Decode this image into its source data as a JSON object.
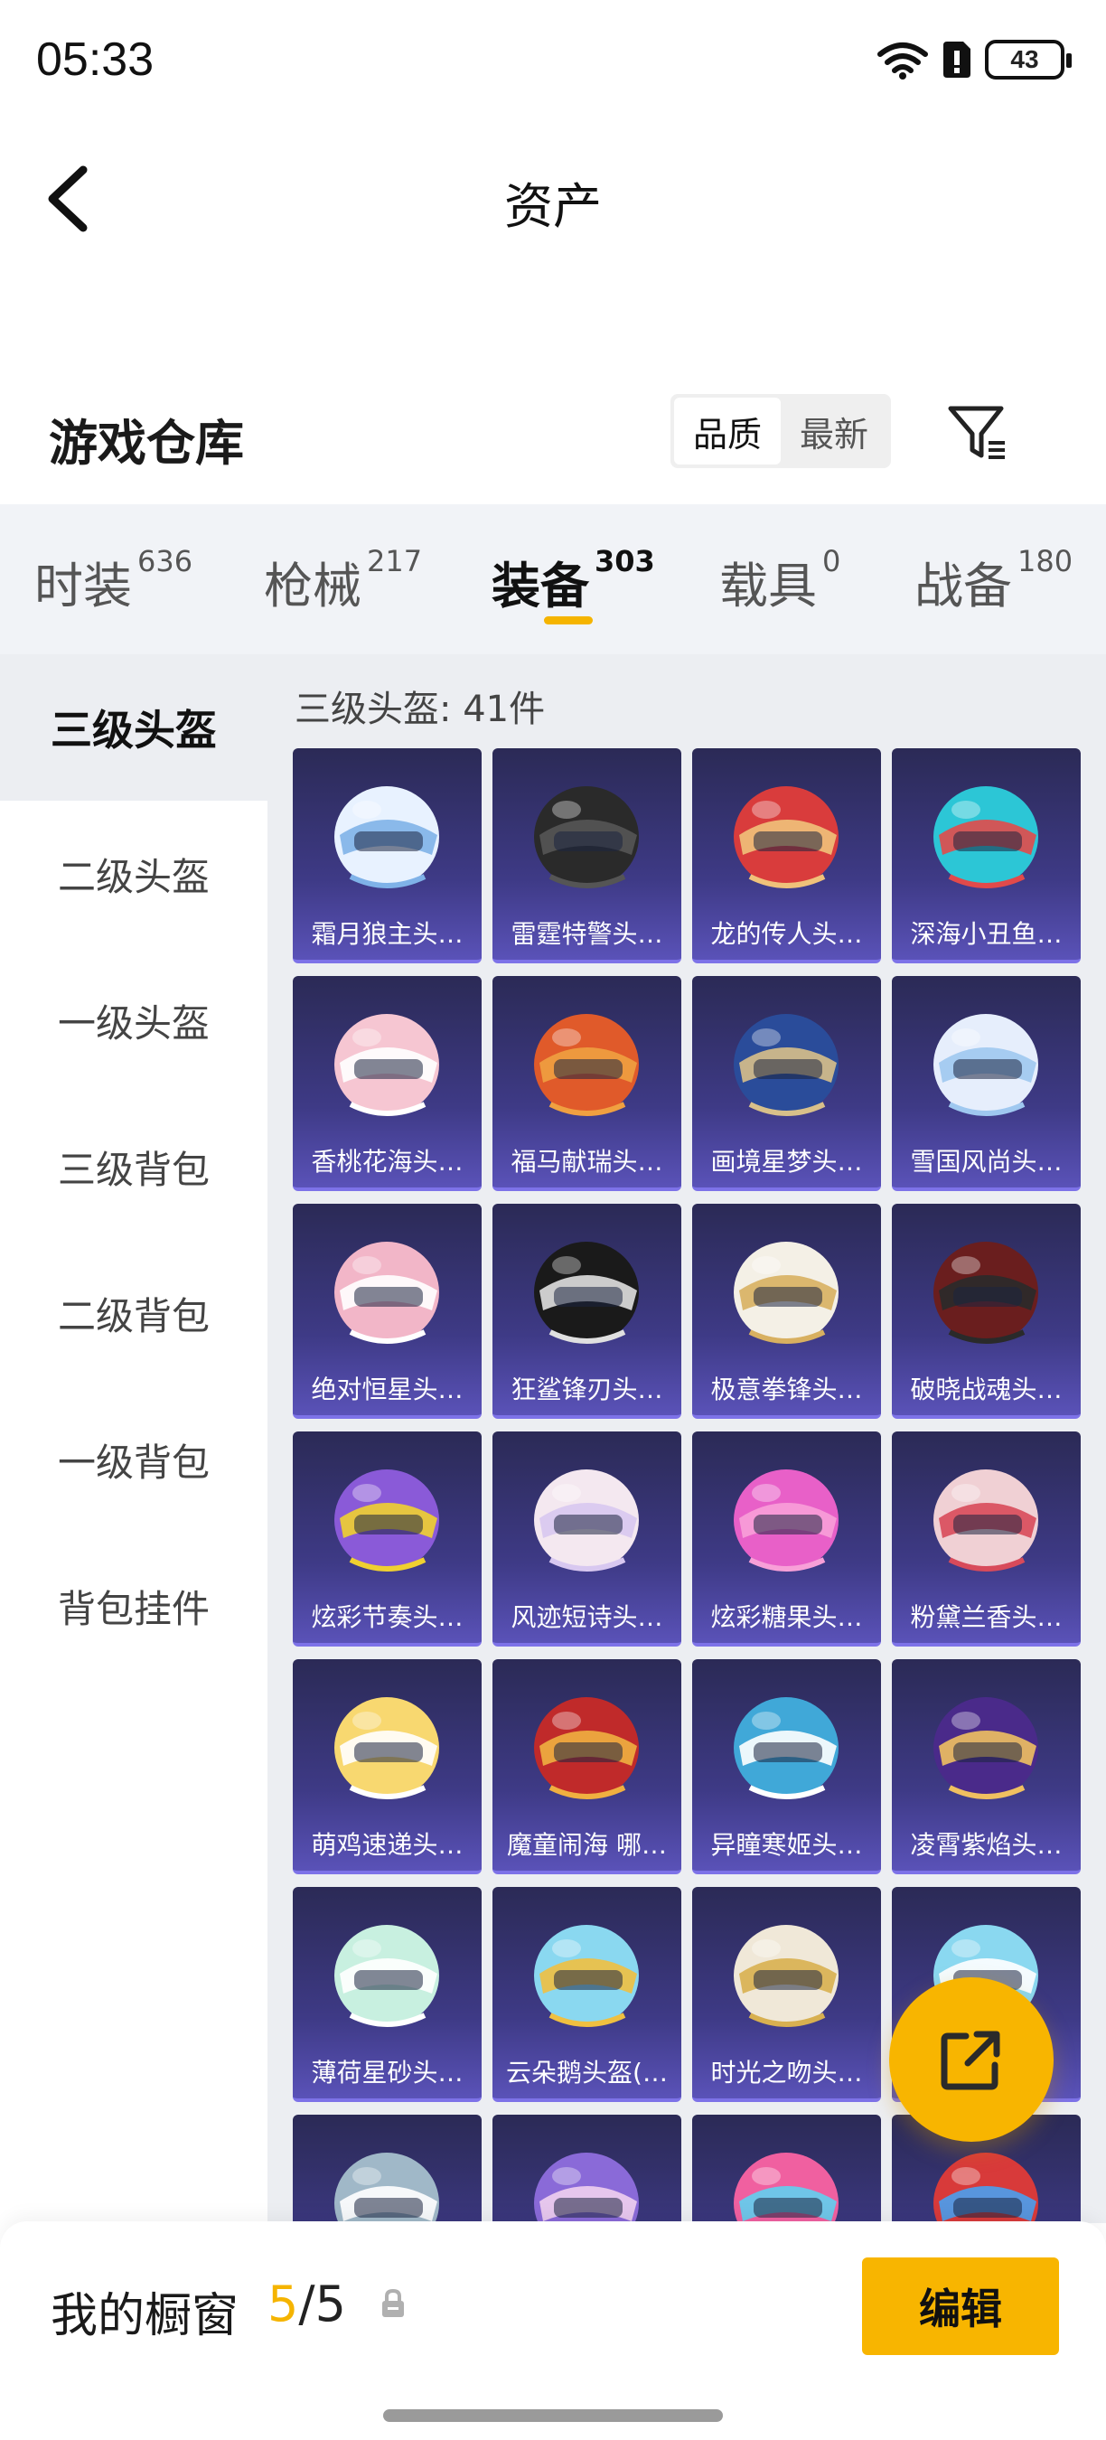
{
  "status_bar": {
    "time": "05:33",
    "battery": "43"
  },
  "header": {
    "title": "资产"
  },
  "warehouse": {
    "title": "游戏仓库",
    "sort_options": [
      "品质",
      "最新"
    ],
    "sort_selected": "品质"
  },
  "tabs": [
    {
      "label": "时装",
      "count": "636"
    },
    {
      "label": "枪械",
      "count": "217"
    },
    {
      "label": "装备",
      "count": "303"
    },
    {
      "label": "载具",
      "count": "0"
    },
    {
      "label": "战备",
      "count": "180"
    }
  ],
  "active_tab": "装备",
  "sidebar": {
    "items": [
      "三级头盔",
      "二级头盔",
      "一级头盔",
      "三级背包",
      "二级背包",
      "一级背包",
      "背包挂件"
    ],
    "active": "三级头盔"
  },
  "content": {
    "count_label": "三级头盔: 41件",
    "items": [
      {
        "name": "霜月狼主头…",
        "colors": [
          "#e8f2ff",
          "#7fb2e8"
        ]
      },
      {
        "name": "雷霆特警头…",
        "colors": [
          "#2a2a2a",
          "#555555"
        ]
      },
      {
        "name": "龙的传人头…",
        "colors": [
          "#d93c3c",
          "#f0c27a"
        ]
      },
      {
        "name": "深海小丑鱼…",
        "colors": [
          "#2cc6d6",
          "#e24a4a"
        ]
      },
      {
        "name": "香桃花海头…",
        "colors": [
          "#f6c6d2",
          "#ffffff"
        ]
      },
      {
        "name": "福马献瑞头…",
        "colors": [
          "#e05a2a",
          "#f0a040"
        ]
      },
      {
        "name": "画境星梦头…",
        "colors": [
          "#2a4c9a",
          "#d8c08a"
        ]
      },
      {
        "name": "雪国风尚头…",
        "colors": [
          "#e6eefc",
          "#9fc8f0"
        ]
      },
      {
        "name": "绝对恒星头…",
        "colors": [
          "#f2b6c8",
          "#ffffff"
        ]
      },
      {
        "name": "狂鲨锋刃头…",
        "colors": [
          "#1a1a1a",
          "#e0e0e0"
        ]
      },
      {
        "name": "极意拳锋头…",
        "colors": [
          "#f4f0e6",
          "#d8b060"
        ]
      },
      {
        "name": "破晓战魂头…",
        "colors": [
          "#6a1e1e",
          "#2a2a2a"
        ]
      },
      {
        "name": "炫彩节奏头…",
        "colors": [
          "#8a5ad8",
          "#f0d030"
        ]
      },
      {
        "name": "风迹短诗头…",
        "colors": [
          "#f4e8f0",
          "#d8c8f0"
        ]
      },
      {
        "name": "炫彩糖果头…",
        "colors": [
          "#e860c8",
          "#f8a0d8"
        ]
      },
      {
        "name": "粉黛兰香头…",
        "colors": [
          "#f0d0d4",
          "#d84a5a"
        ]
      },
      {
        "name": "萌鸡速递头…",
        "colors": [
          "#f8d870",
          "#ffffff"
        ]
      },
      {
        "name": "魔童闹海 哪…",
        "colors": [
          "#c02a2a",
          "#f0b040"
        ]
      },
      {
        "name": "异瞳寒姬头…",
        "colors": [
          "#40a8d8",
          "#ffffff"
        ]
      },
      {
        "name": "凌霄紫焰头…",
        "colors": [
          "#4a2a8a",
          "#f0c060"
        ]
      },
      {
        "name": "薄荷星砂头…",
        "colors": [
          "#c8f0e0",
          "#ffffff"
        ]
      },
      {
        "name": "云朵鹅头盔(…",
        "colors": [
          "#8ad8f0",
          "#f0c040"
        ]
      },
      {
        "name": "时光之吻头…",
        "colors": [
          "#f0e8d8",
          "#d8b050"
        ]
      },
      {
        "name": "",
        "colors": [
          "#8ad8f0",
          "#ffffff"
        ]
      },
      {
        "name": "",
        "colors": [
          "#a0b8c8",
          "#ffffff"
        ]
      },
      {
        "name": "",
        "colors": [
          "#8a6ad8",
          "#f0d0f0"
        ]
      },
      {
        "name": "",
        "colors": [
          "#f060a0",
          "#60d0f0"
        ]
      },
      {
        "name": "",
        "colors": [
          "#d83a3a",
          "#4aa0f0"
        ]
      }
    ]
  },
  "bottom_bar": {
    "label": "我的橱窗",
    "used": "5",
    "separator": "/",
    "total": "5",
    "edit_label": "编辑"
  }
}
